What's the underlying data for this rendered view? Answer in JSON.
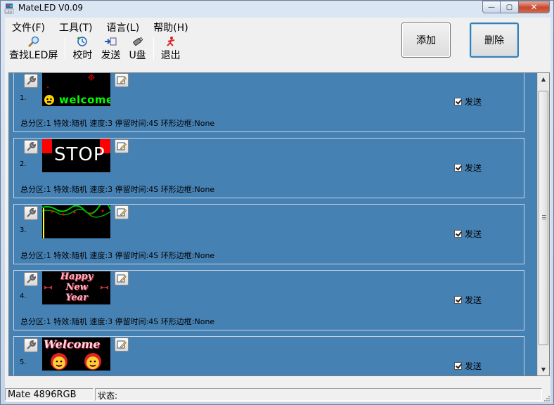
{
  "window": {
    "title": "MateLED  V0.09",
    "controls": {
      "minimize": "—",
      "maximize": "▢",
      "close": "✕"
    }
  },
  "menu": [
    {
      "label": "文件(F)"
    },
    {
      "label": "工具(T)"
    },
    {
      "label": "语言(L)"
    },
    {
      "label": "帮助(H)"
    }
  ],
  "toolbar": {
    "find_led": "查找LED屏",
    "sync_time": "校时",
    "send": "发送",
    "usb": "U盘",
    "exit": "退出"
  },
  "actions": {
    "add": "添加",
    "delete": "删除"
  },
  "programs": [
    {
      "index": "1.",
      "info": "总分区:1  特效:随机  速度:3  停留时间:4S  环形边框:None",
      "send_label": "发送",
      "send_checked": true,
      "preview_text": "welcome"
    },
    {
      "index": "2.",
      "info": "总分区:1  特效:随机  速度:3  停留时间:4S  环形边框:None",
      "send_label": "发送",
      "send_checked": true,
      "preview_text": "STOP"
    },
    {
      "index": "3.",
      "info": "总分区:1  特效:随机  速度:3  停留时间:4S  环形边框:None",
      "send_label": "发送",
      "send_checked": true,
      "preview_text": ""
    },
    {
      "index": "4.",
      "info": "总分区:1  特效:随机  速度:3  停留时间:4S  环形边框:None",
      "send_label": "发送",
      "send_checked": true,
      "preview_lines": [
        "Happy",
        "New",
        "Year"
      ]
    },
    {
      "index": "5.",
      "info": "",
      "send_label": "发送",
      "send_checked": true,
      "preview_text": "Welcome"
    }
  ],
  "statusbar": {
    "model": "Mate 4896RGB",
    "status": "状态:"
  },
  "colors": {
    "list_background": "#4681b4",
    "led_green": "#00ff00",
    "stop_red": "#ff0000"
  },
  "icons": [
    "app-icon",
    "magnifier-icon",
    "clock-sync-icon",
    "send-icon",
    "usb-drive-icon",
    "exit-icon",
    "wrench-icon",
    "edit-icon",
    "checkbox-icon"
  ]
}
